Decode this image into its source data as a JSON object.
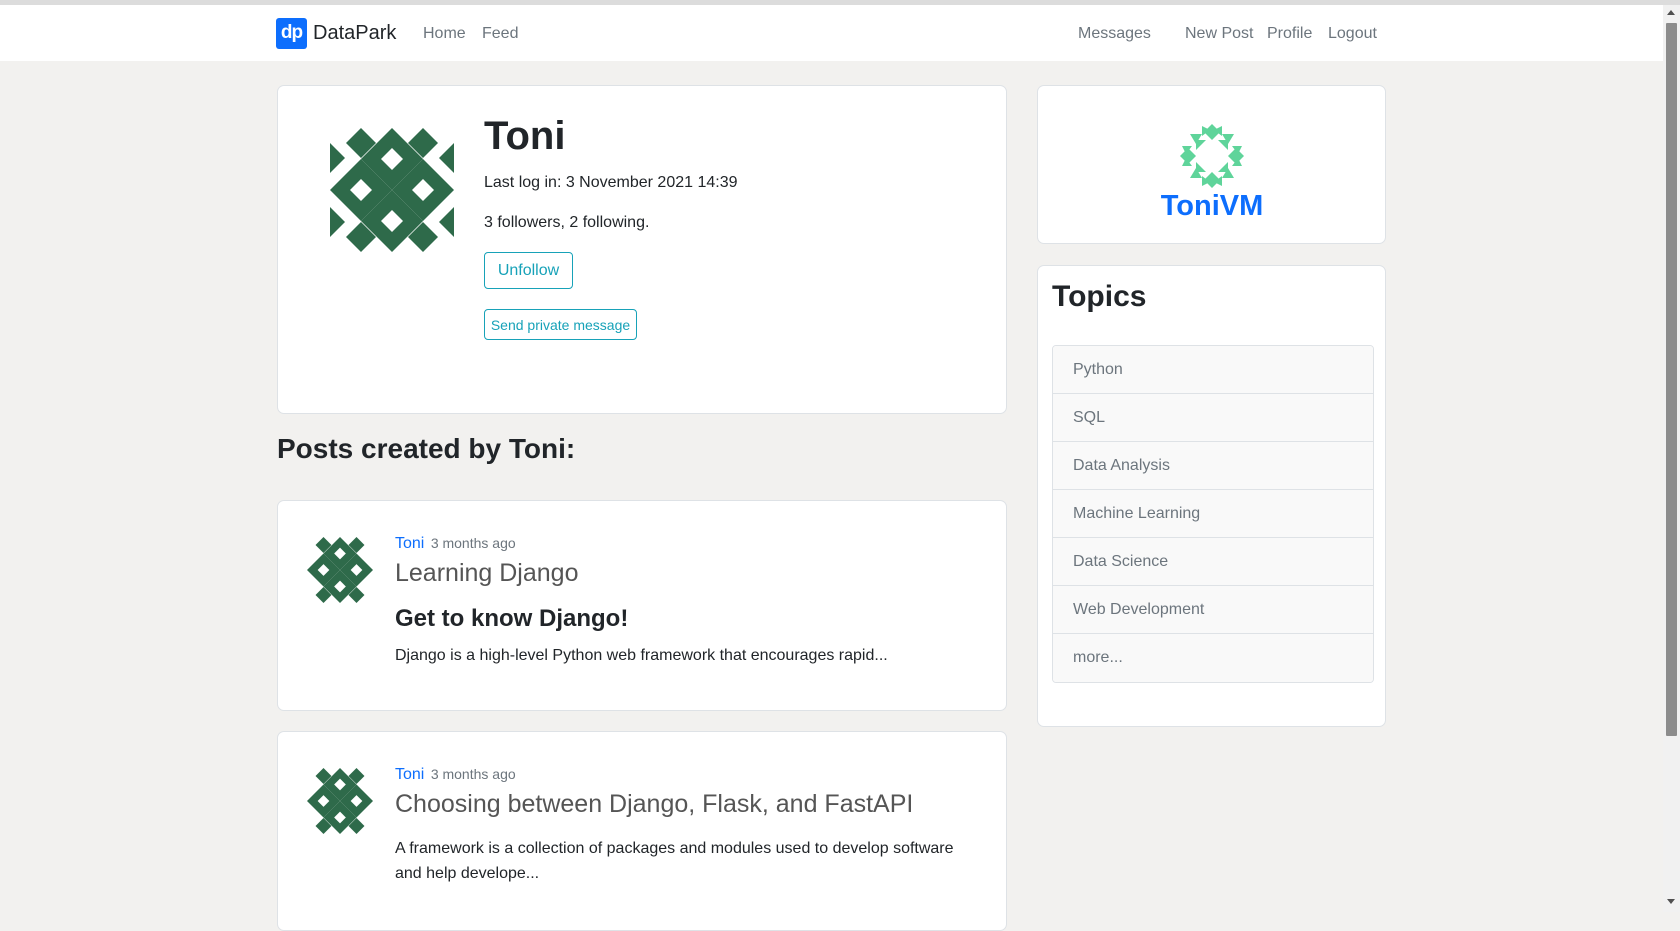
{
  "nav": {
    "brand_logo": "dp",
    "brand_name": "DataPark",
    "home": "Home",
    "feed": "Feed",
    "messages": "Messages",
    "new_post": "New Post",
    "profile": "Profile",
    "logout": "Logout"
  },
  "profile": {
    "name": "Toni",
    "last_log": "Last log in: 3 November 2021 14:39",
    "follow_counts": "3 followers, 2 following.",
    "unfollow_label": "Unfollow",
    "send_message_label": "Send private message",
    "avatar_icon": "identicon-icon",
    "avatar_color": "#2e6a4a"
  },
  "posts_heading": "Posts created by Toni:",
  "posts": [
    {
      "author": "Toni",
      "time": "3 months ago",
      "title": "Learning Django",
      "subheading": "Get to know Django!",
      "excerpt": "Django is a high-level Python web framework that encourages rapid..."
    },
    {
      "author": "Toni",
      "time": "3 months ago",
      "title": "Choosing between Django, Flask, and FastAPI",
      "subheading": "",
      "excerpt": "A framework is a collection of packages and modules used to develop software and help develope..."
    }
  ],
  "sidebar": {
    "username": "ToniVM",
    "logo_icon": "identicon-icon",
    "logo_color": "#5fd49a",
    "topics_title": "Topics",
    "topics": [
      "Python",
      "SQL",
      "Data Analysis",
      "Machine Learning",
      "Data Science",
      "Web Development",
      "more..."
    ]
  },
  "colors": {
    "accent": "#0d6efd",
    "button_outline": "#17a2b8",
    "background": "#f2f1ef"
  }
}
